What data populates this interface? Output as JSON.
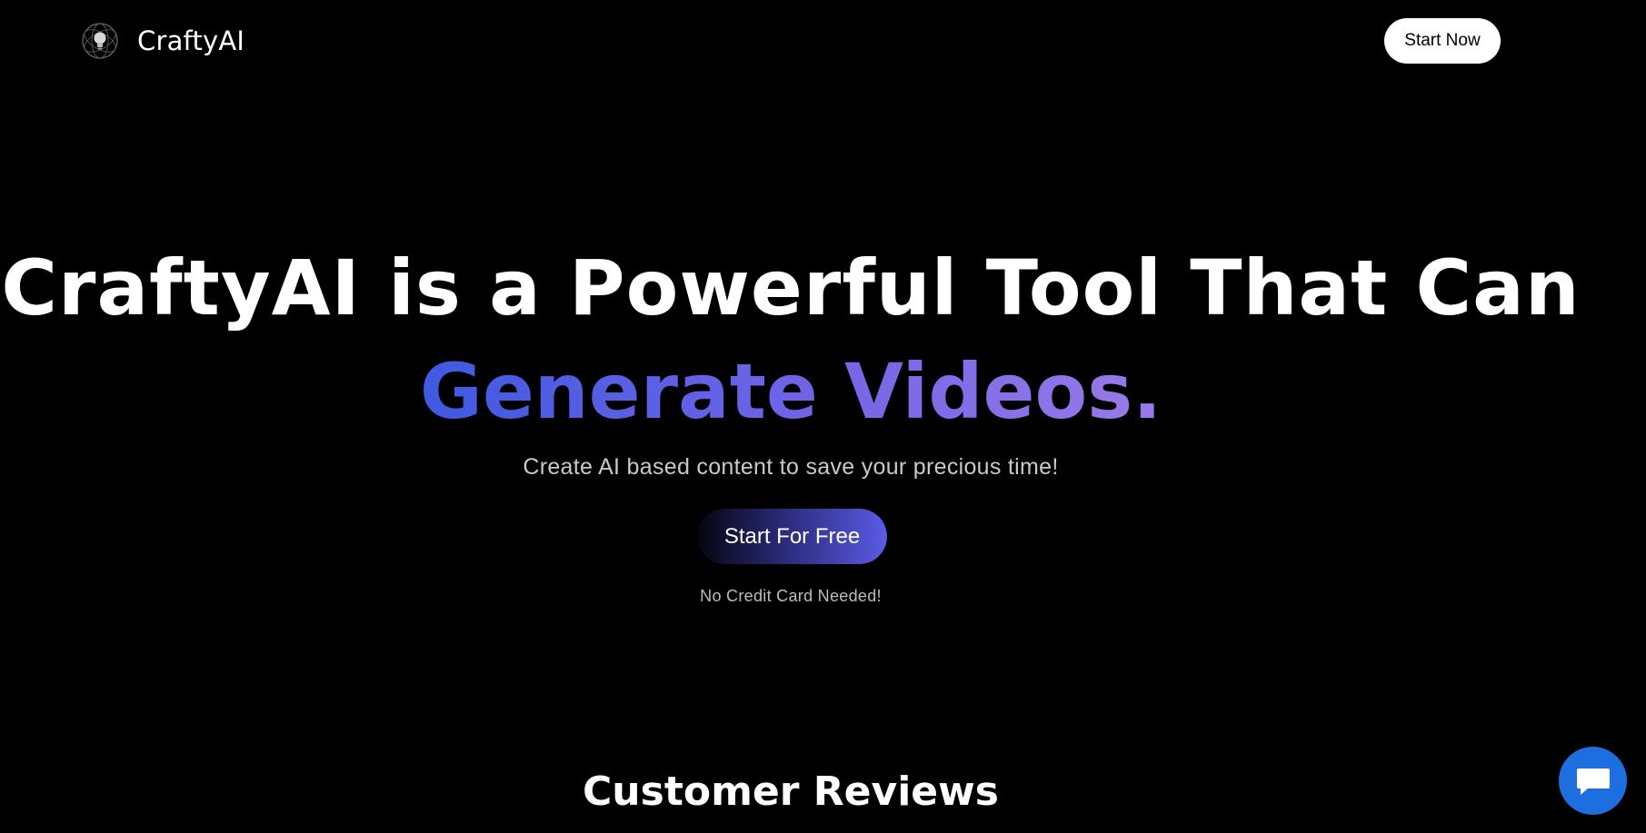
{
  "header": {
    "brand_name": "CraftyAI",
    "logo_icon": "lightbulb-logo-icon",
    "cta_label": "Start Now"
  },
  "hero": {
    "headline_line1": "CraftyAI is a Powerful Tool That Can",
    "headline_line2": "Generate Videos.",
    "subtitle": "Create AI based content to save your precious time!",
    "primary_cta_label": "Start For Free",
    "footnote": "No Credit Card Needed!"
  },
  "reviews": {
    "title": "Customer Reviews"
  },
  "chat_widget": {
    "icon": "chat-bubble-icon"
  },
  "colors": {
    "background": "#000000",
    "gradient_start": "#3f5ae0",
    "gradient_end": "#9a7ae8",
    "chat_button": "#1d6fe0"
  }
}
